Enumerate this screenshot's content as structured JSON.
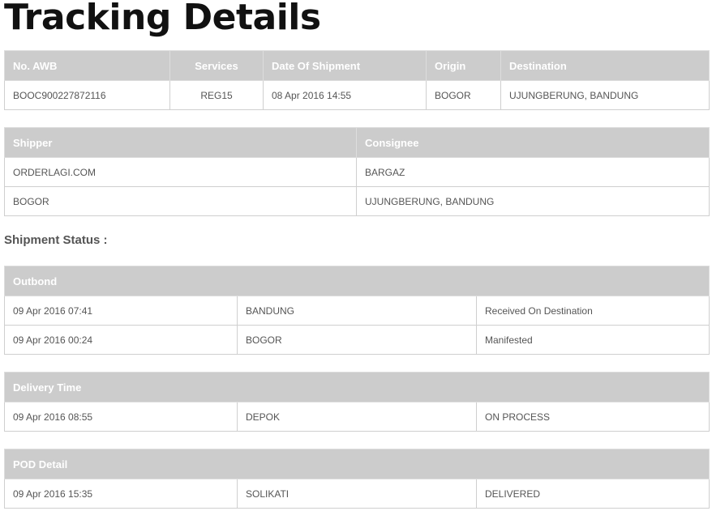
{
  "page": {
    "title": "Tracking Details"
  },
  "awb_table": {
    "headers": {
      "awb": "No. AWB",
      "services": "Services",
      "date": "Date Of Shipment",
      "origin": "Origin",
      "destination": "Destination"
    },
    "row": {
      "awb": "BOOC900227872116",
      "services": "REG15",
      "date": "08 Apr 2016 14:55",
      "origin": "BOGOR",
      "destination": "UJUNGBERUNG, BANDUNG"
    }
  },
  "party_table": {
    "headers": {
      "shipper": "Shipper",
      "consignee": "Consignee"
    },
    "rows": [
      {
        "shipper": "ORDERLAGI.COM",
        "consignee": "BARGAZ"
      },
      {
        "shipper": "BOGOR",
        "consignee": "UJUNGBERUNG, BANDUNG"
      }
    ]
  },
  "shipment_status": {
    "label": "Shipment Status :"
  },
  "outbond": {
    "header": "Outbond",
    "rows": [
      {
        "time": "09 Apr 2016 07:41",
        "location": "BANDUNG",
        "status": "Received On Destination"
      },
      {
        "time": "09 Apr 2016 00:24",
        "location": "BOGOR",
        "status": "Manifested"
      }
    ]
  },
  "delivery_time": {
    "header": "Delivery Time",
    "rows": [
      {
        "time": "09 Apr 2016 08:55",
        "location": "DEPOK",
        "status": "ON PROCESS"
      }
    ]
  },
  "pod_detail": {
    "header": "POD Detail",
    "rows": [
      {
        "time": "09 Apr 2016 15:35",
        "receiver": "SOLIKATI",
        "status": "DELIVERED"
      }
    ]
  },
  "colors": {
    "header_bg": "#cccccc",
    "header_text": "#ffffff",
    "border": "#cfcfcf",
    "body_text": "#555555",
    "title_text": "#111111"
  }
}
